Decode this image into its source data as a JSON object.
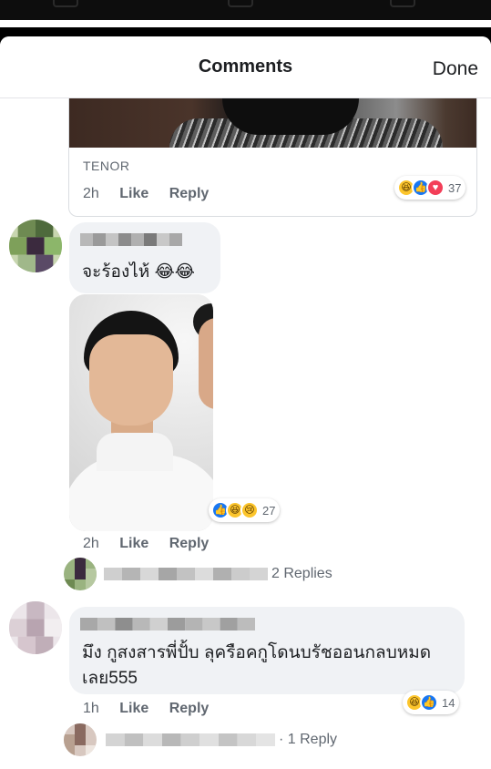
{
  "header": {
    "title": "Comments",
    "done_label": "Done"
  },
  "comments": [
    {
      "attachment_source": "TENOR",
      "time": "2h",
      "like_label": "Like",
      "reply_label": "Reply",
      "reactions": [
        "haha",
        "like",
        "love"
      ],
      "reaction_count": "37"
    },
    {
      "text": "จะร้องไห้ 😂😂",
      "time": "2h",
      "like_label": "Like",
      "reply_label": "Reply",
      "reactions": [
        "like",
        "haha",
        "sad"
      ],
      "reaction_count": "27",
      "replies_label": "2 Replies"
    },
    {
      "text_line1": "มึง กูสงสารพี่ปั้บ ลุครือคกูโดนบรัชออนกลบหมด",
      "text_line2": "เลย555",
      "time": "1h",
      "like_label": "Like",
      "reply_label": "Reply",
      "reactions": [
        "haha",
        "like"
      ],
      "reaction_count": "14",
      "replies_label": "· 1 Reply"
    }
  ],
  "colors": {
    "accent_blue": "#1877f2",
    "bubble_bg": "#f0f2f5",
    "secondary_text": "#606770",
    "love_red": "#f33e58",
    "haha_yellow": "#fcc52c"
  },
  "icons": {
    "haha": "haha-reaction-icon",
    "like": "like-reaction-icon",
    "love": "love-reaction-icon",
    "sad": "sad-reaction-icon"
  }
}
